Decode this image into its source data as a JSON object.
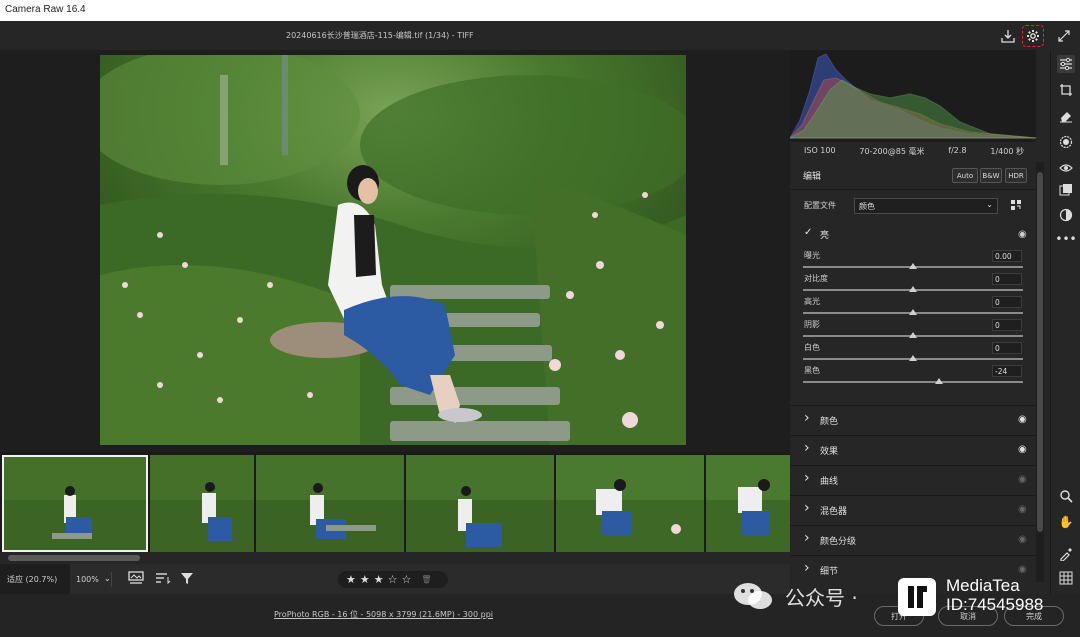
{
  "window": {
    "title": "Camera Raw 16.4"
  },
  "header": {
    "file_title": "20240616长沙普瑞酒店-115-编辑.tif (1/34) -  TIFF"
  },
  "histogram": {
    "colors": {
      "red": "#c0504a",
      "green": "#55a34a",
      "blue": "#3f5fd0"
    }
  },
  "exif": {
    "iso": "ISO 100",
    "lens": "70-200@85 毫米",
    "aperture": "f/2.8",
    "shutter": "1/400 秒"
  },
  "edit": {
    "title": "编辑",
    "auto_label": "Auto",
    "bw_label": "B&W",
    "hdr_label": "HDR",
    "profile_label": "配置文件",
    "profile_value": "颜色"
  },
  "light": {
    "title": "亮",
    "sliders": [
      {
        "label": "曝光",
        "value": "0.00",
        "position": 0.5
      },
      {
        "label": "对比度",
        "value": "0",
        "position": 0.5
      },
      {
        "label": "高光",
        "value": "0",
        "position": 0.5
      },
      {
        "label": "阴影",
        "value": "0",
        "position": 0.5
      },
      {
        "label": "白色",
        "value": "0",
        "position": 0.5
      },
      {
        "label": "黑色",
        "value": "-24",
        "position": 0.62
      }
    ]
  },
  "sections": [
    {
      "label": "颜色"
    },
    {
      "label": "效果"
    },
    {
      "label": "曲线"
    },
    {
      "label": "混色器"
    },
    {
      "label": "颜色分级"
    },
    {
      "label": "细节"
    }
  ],
  "bottom": {
    "zoom_fit": "适应 (20.7%)",
    "zoom_pct": "100%",
    "rating": 3,
    "rating_max": 5
  },
  "status": {
    "info": "ProPhoto RGB - 16 位 - 5098 x 3799 (21.6MP) - 300 ppi",
    "open_label": "打开",
    "cancel_label": "取消",
    "done_label": "完成"
  },
  "watermark": {
    "channel": "公众号 · ",
    "brand": "MediaTea",
    "id": "ID:74545988"
  }
}
